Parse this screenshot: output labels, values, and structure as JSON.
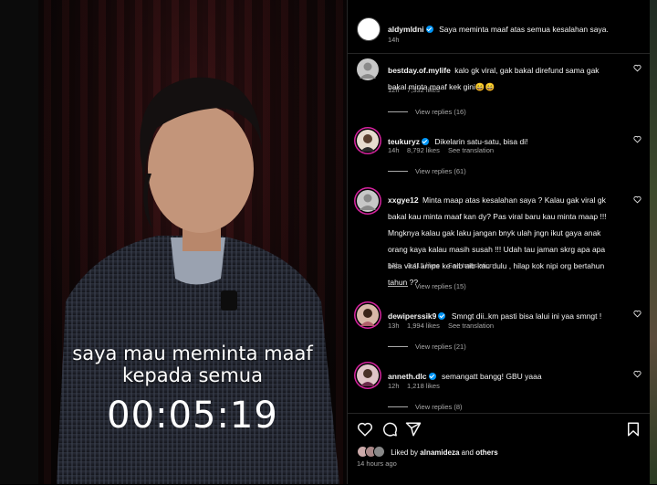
{
  "video": {
    "caption_line1": "saya mau meminta maaf",
    "caption_line2": "kepada semua",
    "timer": "00:05:19"
  },
  "post": {
    "username": "aldymldni",
    "caption": "Saya meminta maaf atas semua kesalahan saya.",
    "time": "14h"
  },
  "comments": [
    {
      "username": "bestday.of.mylife",
      "verified": false,
      "text": "kalo gk viral, gak bakal direfund sama gak bakal minta maaf kek gini😄😄",
      "time": "12h",
      "likes": "7,332 likes",
      "see_translation": "",
      "view_replies": "View replies (16)"
    },
    {
      "username": "teukuryz",
      "verified": true,
      "text": "Dikelarin satu-satu, bisa di!",
      "time": "14h",
      "likes": "8,792 likes",
      "see_translation": "See translation",
      "view_replies": "View replies (61)"
    },
    {
      "username": "xxgye12",
      "verified": false,
      "text": "Minta maap atas kesalahan saya ? Kalau gak viral gk bakal kau minta maaf kan dy? Pas viral baru kau minta maap !!! Mngknya kalau gak laku jangan bnyk ulah jngn ikut gaya anak orang kaya kalau masih susah !!! Udah tau jaman skrg apa apa bisa viral ampe ke aib aib kau dulu , hilap kok nipi org bertahun tahun ??",
      "time": "14h",
      "likes": "3,415 likes",
      "see_translation": "See translation",
      "view_replies": "View replies (15)"
    },
    {
      "username": "dewiperssik9",
      "verified": true,
      "text": "Smngt dii..km pasti bisa lalui ini yaa smngt !",
      "time": "13h",
      "likes": "1,994 likes",
      "see_translation": "See translation",
      "view_replies": "View replies (21)"
    },
    {
      "username": "anneth.dlc",
      "verified": true,
      "text": "semangatt bangg! GBU yaaa",
      "time": "12h",
      "likes": "1,218 likes",
      "see_translation": "",
      "view_replies": "View replies (8)"
    }
  ],
  "footer": {
    "liked_by_prefix": "Liked by",
    "liked_by_user": "alnamideza",
    "liked_by_and": "and",
    "liked_by_others": "others",
    "time_ago": "14 hours ago"
  },
  "icons": [
    "heart-icon",
    "comment-icon",
    "share-icon",
    "bookmark-icon",
    "verified-badge-icon"
  ],
  "colors": {
    "accent": "#0095f6",
    "story_ring": "#d6249f",
    "background": "#000000",
    "muted_text": "#a8a8a8"
  }
}
